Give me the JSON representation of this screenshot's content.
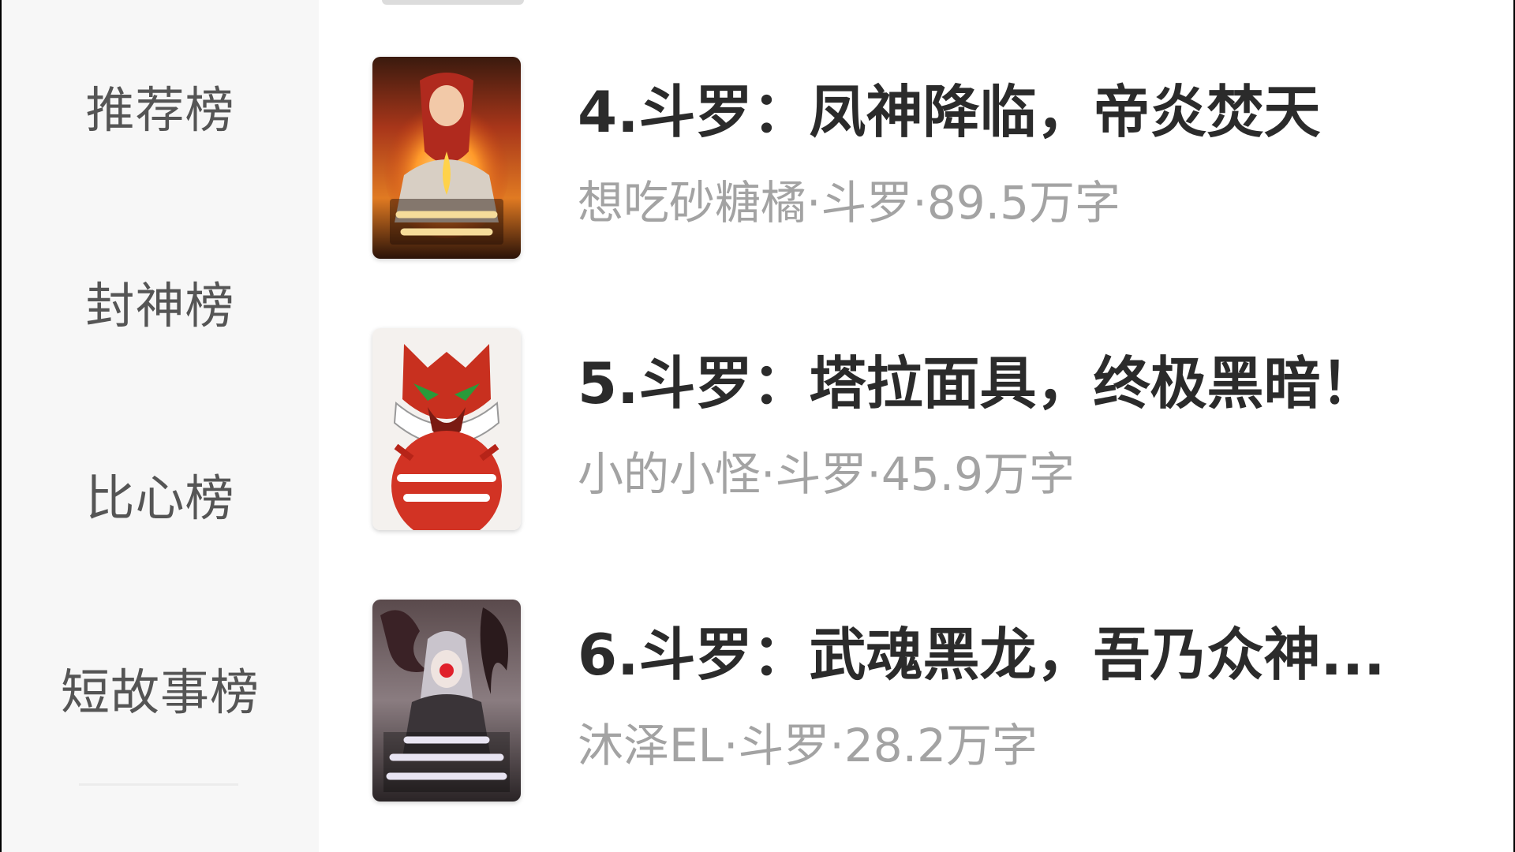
{
  "sidebar": {
    "items": [
      {
        "label": "推荐榜"
      },
      {
        "label": "封神榜"
      },
      {
        "label": "比心榜"
      },
      {
        "label": "短故事榜"
      }
    ]
  },
  "books": [
    {
      "title": "4.斗罗：凤神降临，帝炎焚天",
      "meta": "想吃砂糖橘·斗罗·89.5万字",
      "cover_icon": "book-cover-phoenix-fire"
    },
    {
      "title": "5.斗罗：塔拉面具，终极黑暗！",
      "meta": "小的小怪·斗罗·45.9万字",
      "cover_icon": "book-cover-red-mask"
    },
    {
      "title": "6.斗罗：武魂黑龙，吾乃众神...",
      "meta": "沐泽EL·斗罗·28.2万字",
      "cover_icon": "book-cover-black-dragon"
    }
  ],
  "colors": {
    "sidebar_bg": "#f7f7f7",
    "sidebar_text": "#555555",
    "title_text": "#2b2b2b",
    "meta_text": "#a3a3a3"
  }
}
